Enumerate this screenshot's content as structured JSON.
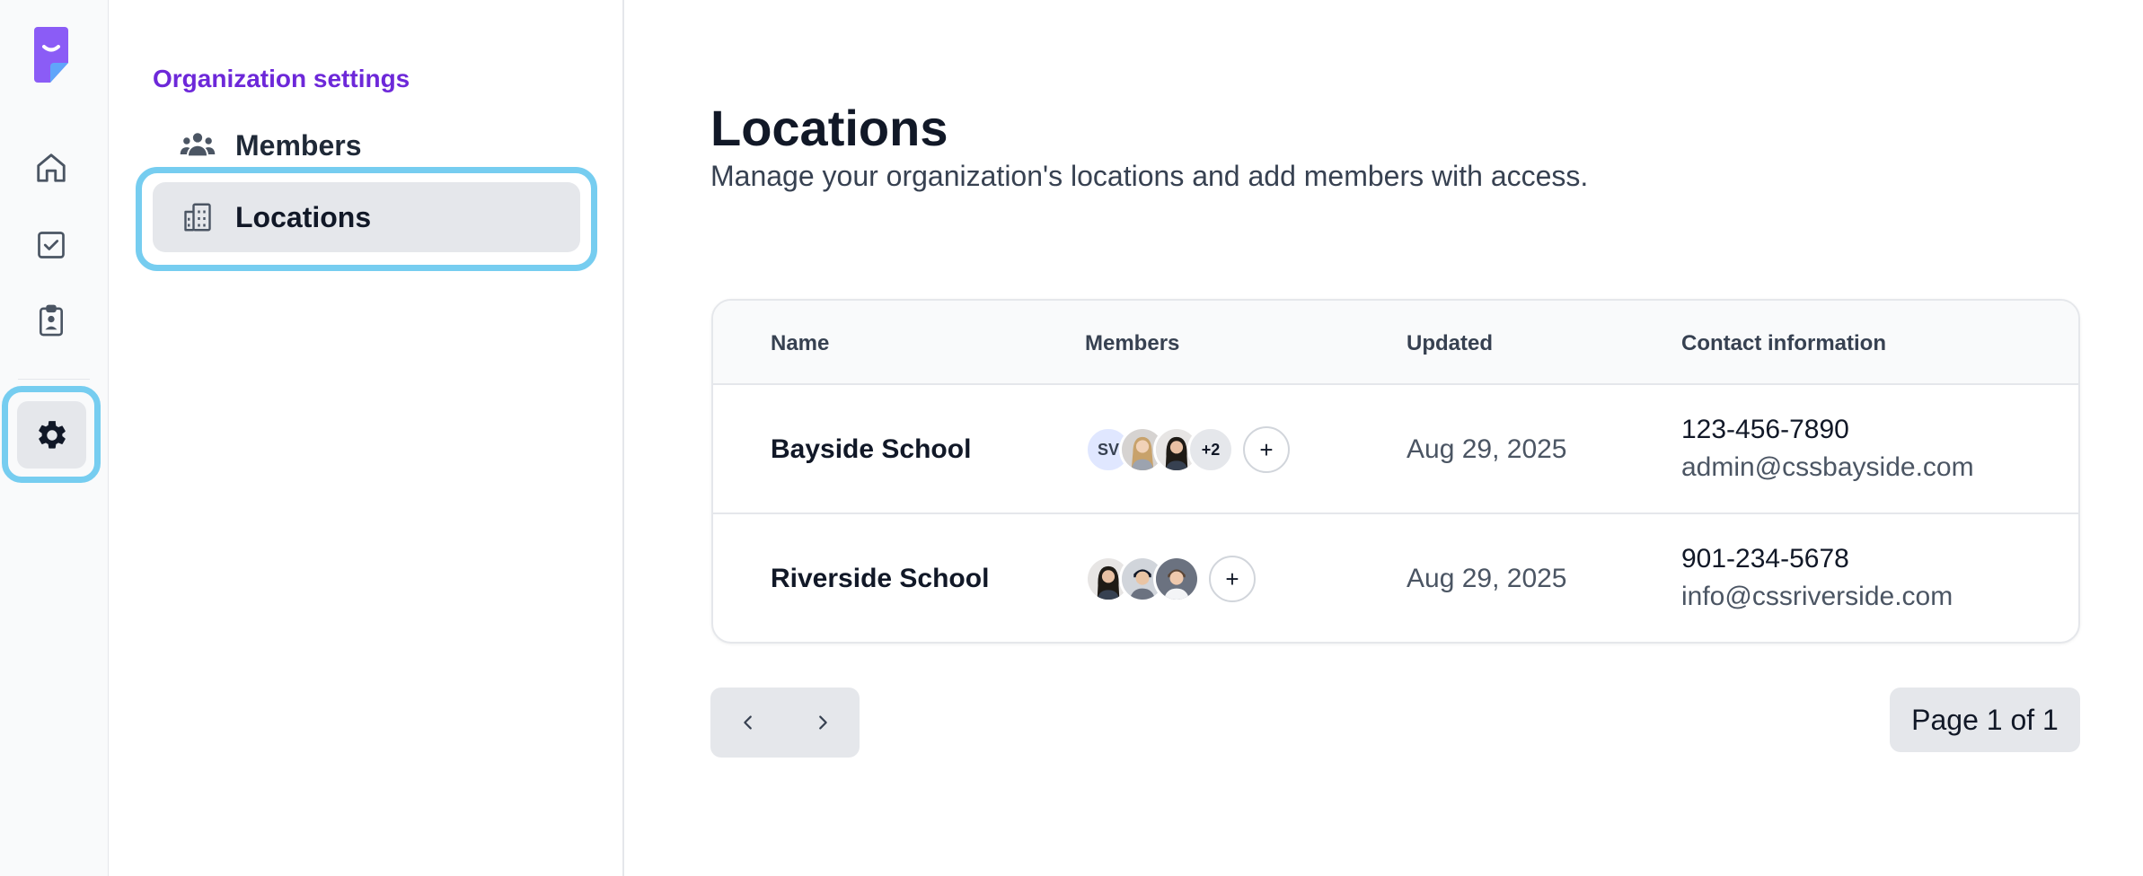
{
  "rail": {
    "items": [
      {
        "name": "home-icon"
      },
      {
        "name": "checkbox-icon"
      },
      {
        "name": "clipboard-badge-icon"
      },
      {
        "name": "gear-icon",
        "active": true
      }
    ]
  },
  "settings_nav": {
    "heading": "Organization settings",
    "items": [
      {
        "label": "Members",
        "icon": "users-icon"
      },
      {
        "label": "Locations",
        "icon": "building-icon",
        "active": true
      }
    ]
  },
  "main": {
    "title": "Locations",
    "subtitle": "Manage your organization's locations and add members with access."
  },
  "table": {
    "columns": [
      "Name",
      "Members",
      "Updated",
      "Contact information"
    ],
    "rows": [
      {
        "name": "Bayside School",
        "avatars": {
          "initials": "SV",
          "more": "+2"
        },
        "add_label": "+",
        "updated": "Aug 29, 2025",
        "phone": "123-456-7890",
        "email": "admin@cssbayside.com"
      },
      {
        "name": "Riverside School",
        "add_label": "+",
        "updated": "Aug 29, 2025",
        "phone": "901-234-5678",
        "email": "info@cssriverside.com"
      }
    ]
  },
  "pagination": {
    "indicator": "Page 1 of 1"
  },
  "colors": {
    "accent": "#6d28d9",
    "highlight_ring": "#76cdf0",
    "logo": "#8b5cf6"
  }
}
